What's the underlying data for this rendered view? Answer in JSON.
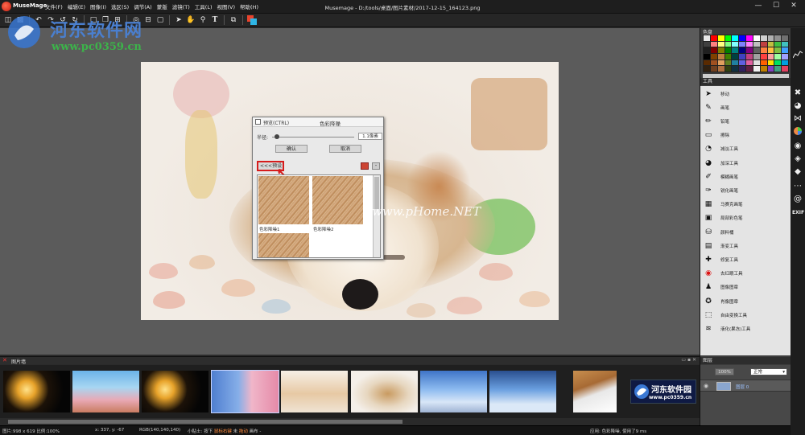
{
  "app": {
    "name": "MuseMage",
    "window_title": "Musemage - D:/tools/桌面/图片素材/2017-12-15_164123.png"
  },
  "menu": [
    "文件(F)",
    "编辑(E)",
    "图像(I)",
    "选区(S)",
    "调节(A)",
    "蒙版",
    "滤镜(T)",
    "工具(L)",
    "视图(V)",
    "帮助(H)"
  ],
  "window_controls": {
    "minimize": "—",
    "maximize": "☐",
    "close": "✕"
  },
  "toolbar_icons": [
    "open-icon",
    "save-icon",
    "undo-icon",
    "redo-icon",
    "rotate-left-icon",
    "rotate-right-icon",
    "new-icon",
    "copy-icon",
    "crop-icon",
    "zoom-fit-icon",
    "actual-size-icon",
    "fullscreen-icon",
    "select-icon",
    "hand-icon",
    "zoom-icon",
    "text-icon",
    "layers-icon",
    "color-swap-icon"
  ],
  "dialog": {
    "preview_label": "预览(CTRL)",
    "title": "色彩降噪",
    "radius_label": "半径:",
    "radius_value": "1.1像素",
    "radius_fraction": 0.03,
    "confirm_label": "确认",
    "cancel_label": "取消",
    "presets_label": "<<<预设",
    "delete_label": "-",
    "presets": [
      {
        "caption": "色彩降噪1"
      },
      {
        "caption": "色彩降噪2"
      }
    ]
  },
  "watermarks": {
    "top_cn": "河东软件网",
    "top_url": "www.pc0359.cn",
    "center": "www.pHome.NET",
    "bottom_cn": "河东软件园",
    "bottom_url": "www.pc0359.cn"
  },
  "right_panel": {
    "palette_title": "色盘",
    "tools_title": "工具",
    "tools": [
      {
        "label": "移动",
        "icon": "move-icon"
      },
      {
        "label": "画笔",
        "icon": "brush-icon"
      },
      {
        "label": "铅笔",
        "icon": "pencil-icon"
      },
      {
        "label": "擦除",
        "icon": "eraser-icon"
      },
      {
        "label": "减淡工具",
        "icon": "dodge-icon"
      },
      {
        "label": "加深工具",
        "icon": "burn-icon"
      },
      {
        "label": "模糊画笔",
        "icon": "blur-brush-icon"
      },
      {
        "label": "锐化画笔",
        "icon": "sharpen-brush-icon"
      },
      {
        "label": "马赛克画笔",
        "icon": "mosaic-brush-icon"
      },
      {
        "label": "局部彩色笔",
        "icon": "partial-color-icon"
      },
      {
        "label": "颜料桶",
        "icon": "paint-bucket-icon"
      },
      {
        "label": "渐变工具",
        "icon": "gradient-icon"
      },
      {
        "label": "修复工具",
        "icon": "heal-icon"
      },
      {
        "label": "去红眼工具",
        "icon": "red-eye-icon"
      },
      {
        "label": "图像图章",
        "icon": "stamp-icon"
      },
      {
        "label": "肖像图章",
        "icon": "portrait-stamp-icon"
      },
      {
        "label": "自由变换工具",
        "icon": "transform-icon"
      },
      {
        "label": "液化(果冻)工具",
        "icon": "liquify-icon"
      }
    ],
    "layers_title": "图层",
    "opacity": "100%",
    "blend_mode": "正常",
    "layer_name": "图层 0"
  },
  "side_strip_icons": [
    "histogram-icon",
    "tools-x-icon",
    "palette-icon",
    "bowtie-icon",
    "color-wheel-icon",
    "camera-icon",
    "drops-icon",
    "diamond-icon",
    "more-icon",
    "at-icon",
    "exif-icon"
  ],
  "side_strip_exif": "EXIF",
  "filmstrip": {
    "title": "图片墙",
    "close": "✕",
    "controls": "▭ ▪ ✕"
  },
  "status": {
    "image_info": "图片:998 x 619 比例:100%",
    "coords": "x: 337, y: -67",
    "rgb": "RGB(140,140,140)",
    "tip_prefix": "小贴士: 按下",
    "tip_key": "鼠标右键",
    "tip_mid": "未",
    "tip_action": "拖动",
    "tip_suffix": "画布 -",
    "app_status": "应用: 色彩降噪, 使用了9 ms"
  },
  "colors": {
    "accent_red": "#d61c1c",
    "watermark_blue": "#4a7fcf",
    "watermark_green": "#3cb44a"
  }
}
